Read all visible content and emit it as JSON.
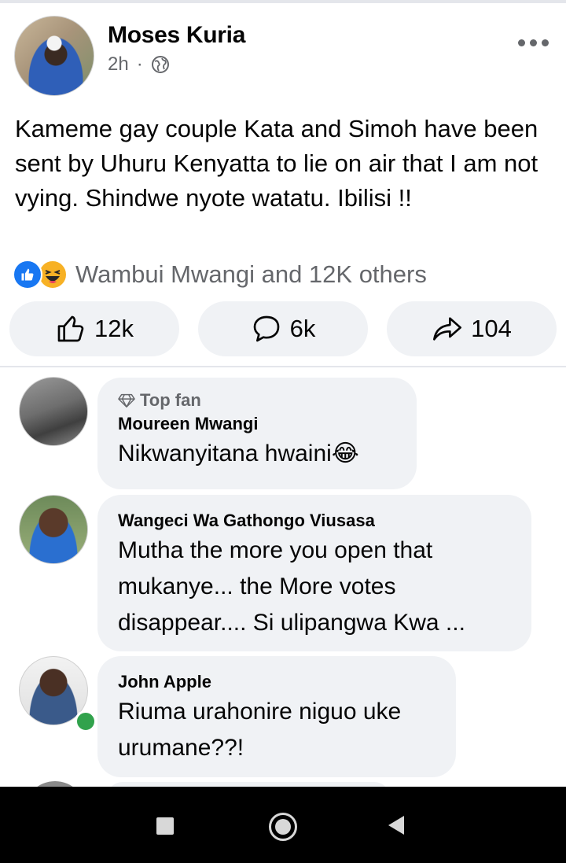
{
  "post": {
    "author": "Moses Kuria",
    "time": "2h",
    "dot": "·",
    "text": "Kameme gay couple Kata and Simoh have been sent by Uhuru Kenyatta to lie on air that I am not vying. Shindwe nyote watatu.  Ibilisi !!",
    "reactions_summary": "Wambui Mwangi and 12K others",
    "actions": {
      "like_count": "12k",
      "comment_count": "6k",
      "share_count": "104"
    }
  },
  "comments": [
    {
      "badge": "Top fan",
      "name": "Moureen Mwangi",
      "text": "Nikwanyitana hwaini😂"
    },
    {
      "name": "Wangeci Wa Gathongo Viusasa",
      "text": "Mutha the more you open that mukanye... the More votes disappear.... Si ulipangwa Kwa ..."
    },
    {
      "name": "John Apple",
      "text": "Riuma urahonire niguo uke urumane??!"
    }
  ],
  "icons": {
    "more": "more-options-icon",
    "privacy": "globe-icon",
    "like": "like-icon",
    "comment": "comment-icon",
    "share": "share-icon",
    "top_fan": "diamond-icon"
  },
  "colors": {
    "accent": "#1877f2",
    "haha": "#f7b125",
    "bubble": "#f0f2f5",
    "muted": "#65676b",
    "online": "#31a24c"
  }
}
